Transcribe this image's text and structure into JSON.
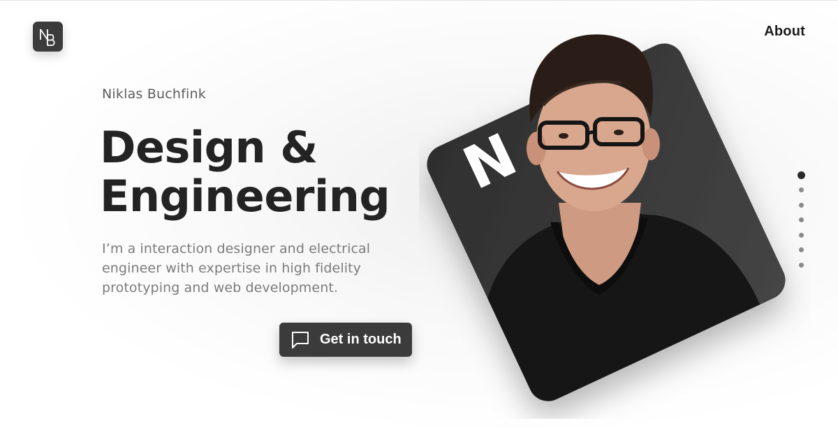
{
  "header": {
    "logo_text": "NB",
    "nav_about": "About"
  },
  "hero": {
    "eyebrow": "Niklas Buchfink",
    "headline_line1": "Design &",
    "headline_line2": "Engineering",
    "lead": "I’m a interaction designer and electrical engineer with expertise in high fidelity prototyping and web development.",
    "cta_label": "Get in touch",
    "cta_icon": "chat-bubble-icon"
  },
  "portrait": {
    "card_letter": "N",
    "card_color": "#3a3a3a"
  },
  "pager": {
    "count": 7,
    "active_index": 0
  },
  "colors": {
    "dark": "#3b3b3b",
    "text_primary": "#232323",
    "text_muted": "#7b7b7b"
  }
}
